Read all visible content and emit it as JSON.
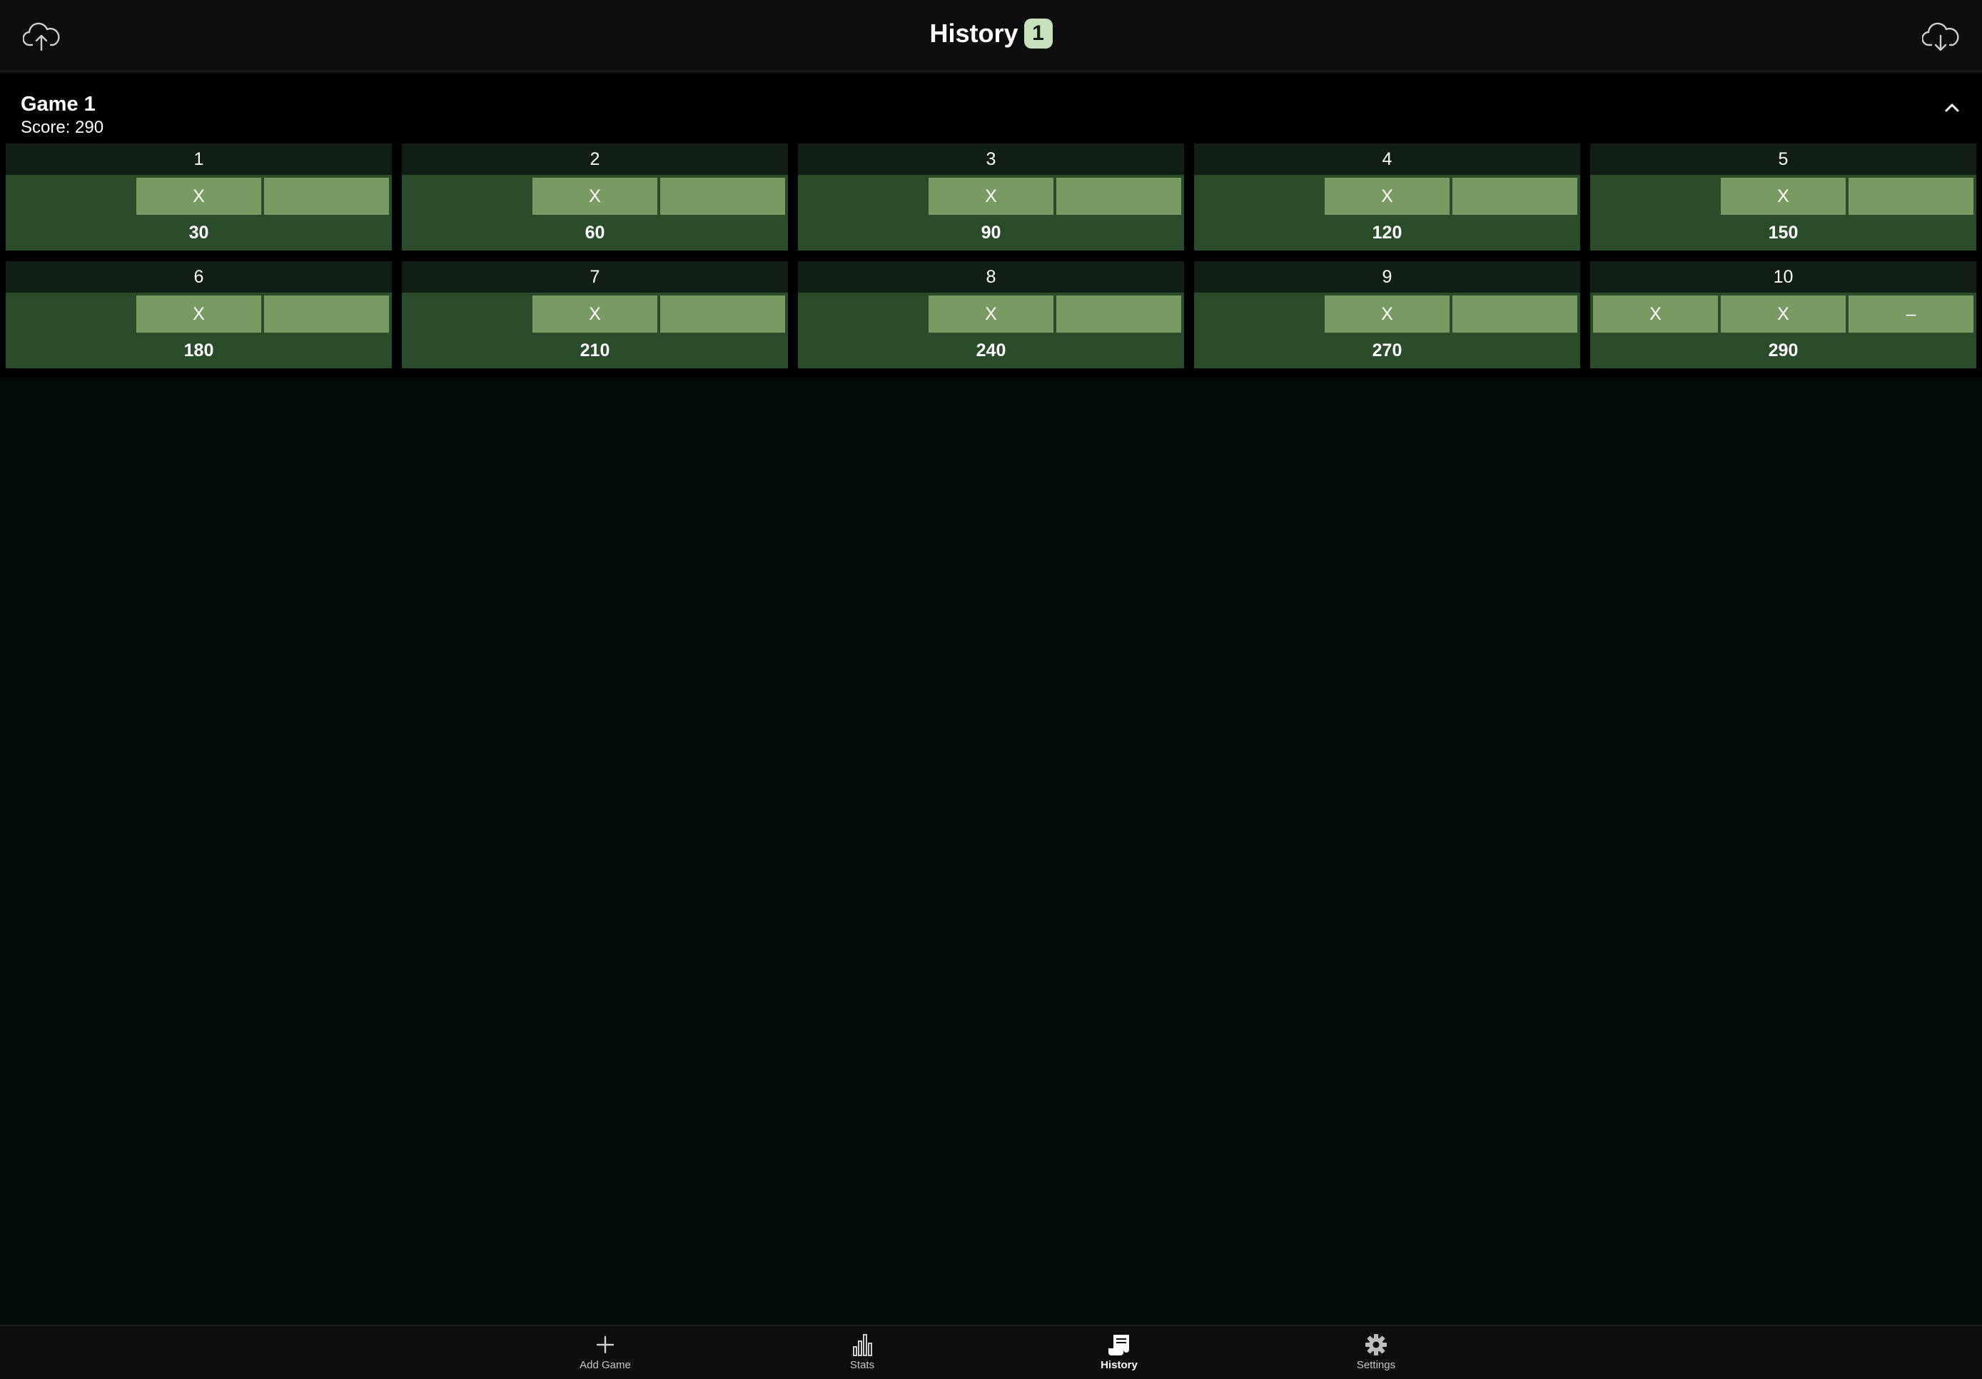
{
  "header": {
    "title": "History",
    "badge": "1",
    "upload_icon": "cloud-upload-icon",
    "download_icon": "cloud-download-icon"
  },
  "game": {
    "title": "Game 1",
    "score_label": "Score: 290",
    "collapse_icon": "chevron-up-icon",
    "frames": [
      {
        "number": "1",
        "rolls": [
          "",
          "X",
          ""
        ],
        "total": "30"
      },
      {
        "number": "2",
        "rolls": [
          "",
          "X",
          ""
        ],
        "total": "60"
      },
      {
        "number": "3",
        "rolls": [
          "",
          "X",
          ""
        ],
        "total": "90"
      },
      {
        "number": "4",
        "rolls": [
          "",
          "X",
          ""
        ],
        "total": "120"
      },
      {
        "number": "5",
        "rolls": [
          "",
          "X",
          ""
        ],
        "total": "150"
      },
      {
        "number": "6",
        "rolls": [
          "",
          "X",
          ""
        ],
        "total": "180"
      },
      {
        "number": "7",
        "rolls": [
          "",
          "X",
          ""
        ],
        "total": "210"
      },
      {
        "number": "8",
        "rolls": [
          "",
          "X",
          ""
        ],
        "total": "240"
      },
      {
        "number": "9",
        "rolls": [
          "",
          "X",
          ""
        ],
        "total": "270"
      },
      {
        "number": "10",
        "rolls": [
          "X",
          "X",
          "–"
        ],
        "total": "290"
      }
    ]
  },
  "nav": {
    "items": [
      {
        "label": "Add Game",
        "icon": "plus-icon"
      },
      {
        "label": "Stats",
        "icon": "bar-chart-icon"
      },
      {
        "label": "History",
        "icon": "scroll-icon",
        "active": true
      },
      {
        "label": "Settings",
        "icon": "gear-icon"
      }
    ]
  },
  "colors": {
    "background": "#020b07",
    "header": "#0d0e0d",
    "frame": "#2a4c2b",
    "frame_header": "#111e13",
    "roll_box": "#7a9a64",
    "badge": "#c7e1bd"
  }
}
